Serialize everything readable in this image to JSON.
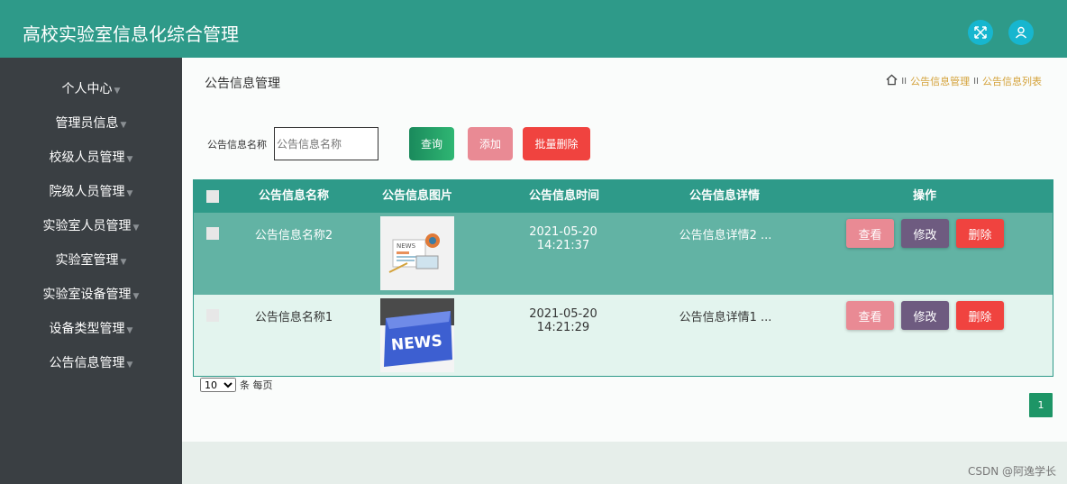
{
  "app": {
    "title": "高校实验室信息化综合管理"
  },
  "header_icons": {
    "fullscreen": "fullscreen-icon",
    "user": "user-icon",
    "accent": "#17b6cf"
  },
  "sidebar": {
    "items": [
      {
        "label": "个人中心"
      },
      {
        "label": "管理员信息"
      },
      {
        "label": "校级人员管理"
      },
      {
        "label": "院级人员管理"
      },
      {
        "label": "实验室人员管理"
      },
      {
        "label": "实验室管理"
      },
      {
        "label": "实验室设备管理"
      },
      {
        "label": "设备类型管理"
      },
      {
        "label": "公告信息管理"
      }
    ]
  },
  "page": {
    "title": "公告信息管理"
  },
  "breadcrumb": {
    "items": [
      "公告信息管理",
      "公告信息列表"
    ],
    "separator": "II"
  },
  "search": {
    "label": "公告信息名称",
    "placeholder": "公告信息名称",
    "value": ""
  },
  "toolbar": {
    "query": "查询",
    "add": "添加",
    "batch_delete": "批量删除"
  },
  "table": {
    "headers": [
      "公告信息名称",
      "公告信息图片",
      "公告信息时间",
      "公告信息详情",
      "操作"
    ],
    "rows": [
      {
        "name": "公告信息名称2",
        "image": "news-illustration",
        "time": "2021-05-20 14:21:37",
        "detail": "公告信息详情2 ...",
        "actions": [
          "查看",
          "修改",
          "删除"
        ]
      },
      {
        "name": "公告信息名称1",
        "image": "news-keyboard-key",
        "time": "2021-05-20 14:21:29",
        "detail": "公告信息详情1 ...",
        "actions": [
          "查看",
          "修改",
          "删除"
        ]
      }
    ]
  },
  "pagination": {
    "page_size": "10",
    "page_size_suffix": "条 每页",
    "current_page": "1"
  },
  "colors": {
    "primary": "#2e9a89",
    "sidebar": "#3a3f43",
    "view": "#e98a94",
    "edit": "#6e5b80",
    "delete": "#f0433f"
  },
  "watermark": "CSDN @阿逸学长"
}
